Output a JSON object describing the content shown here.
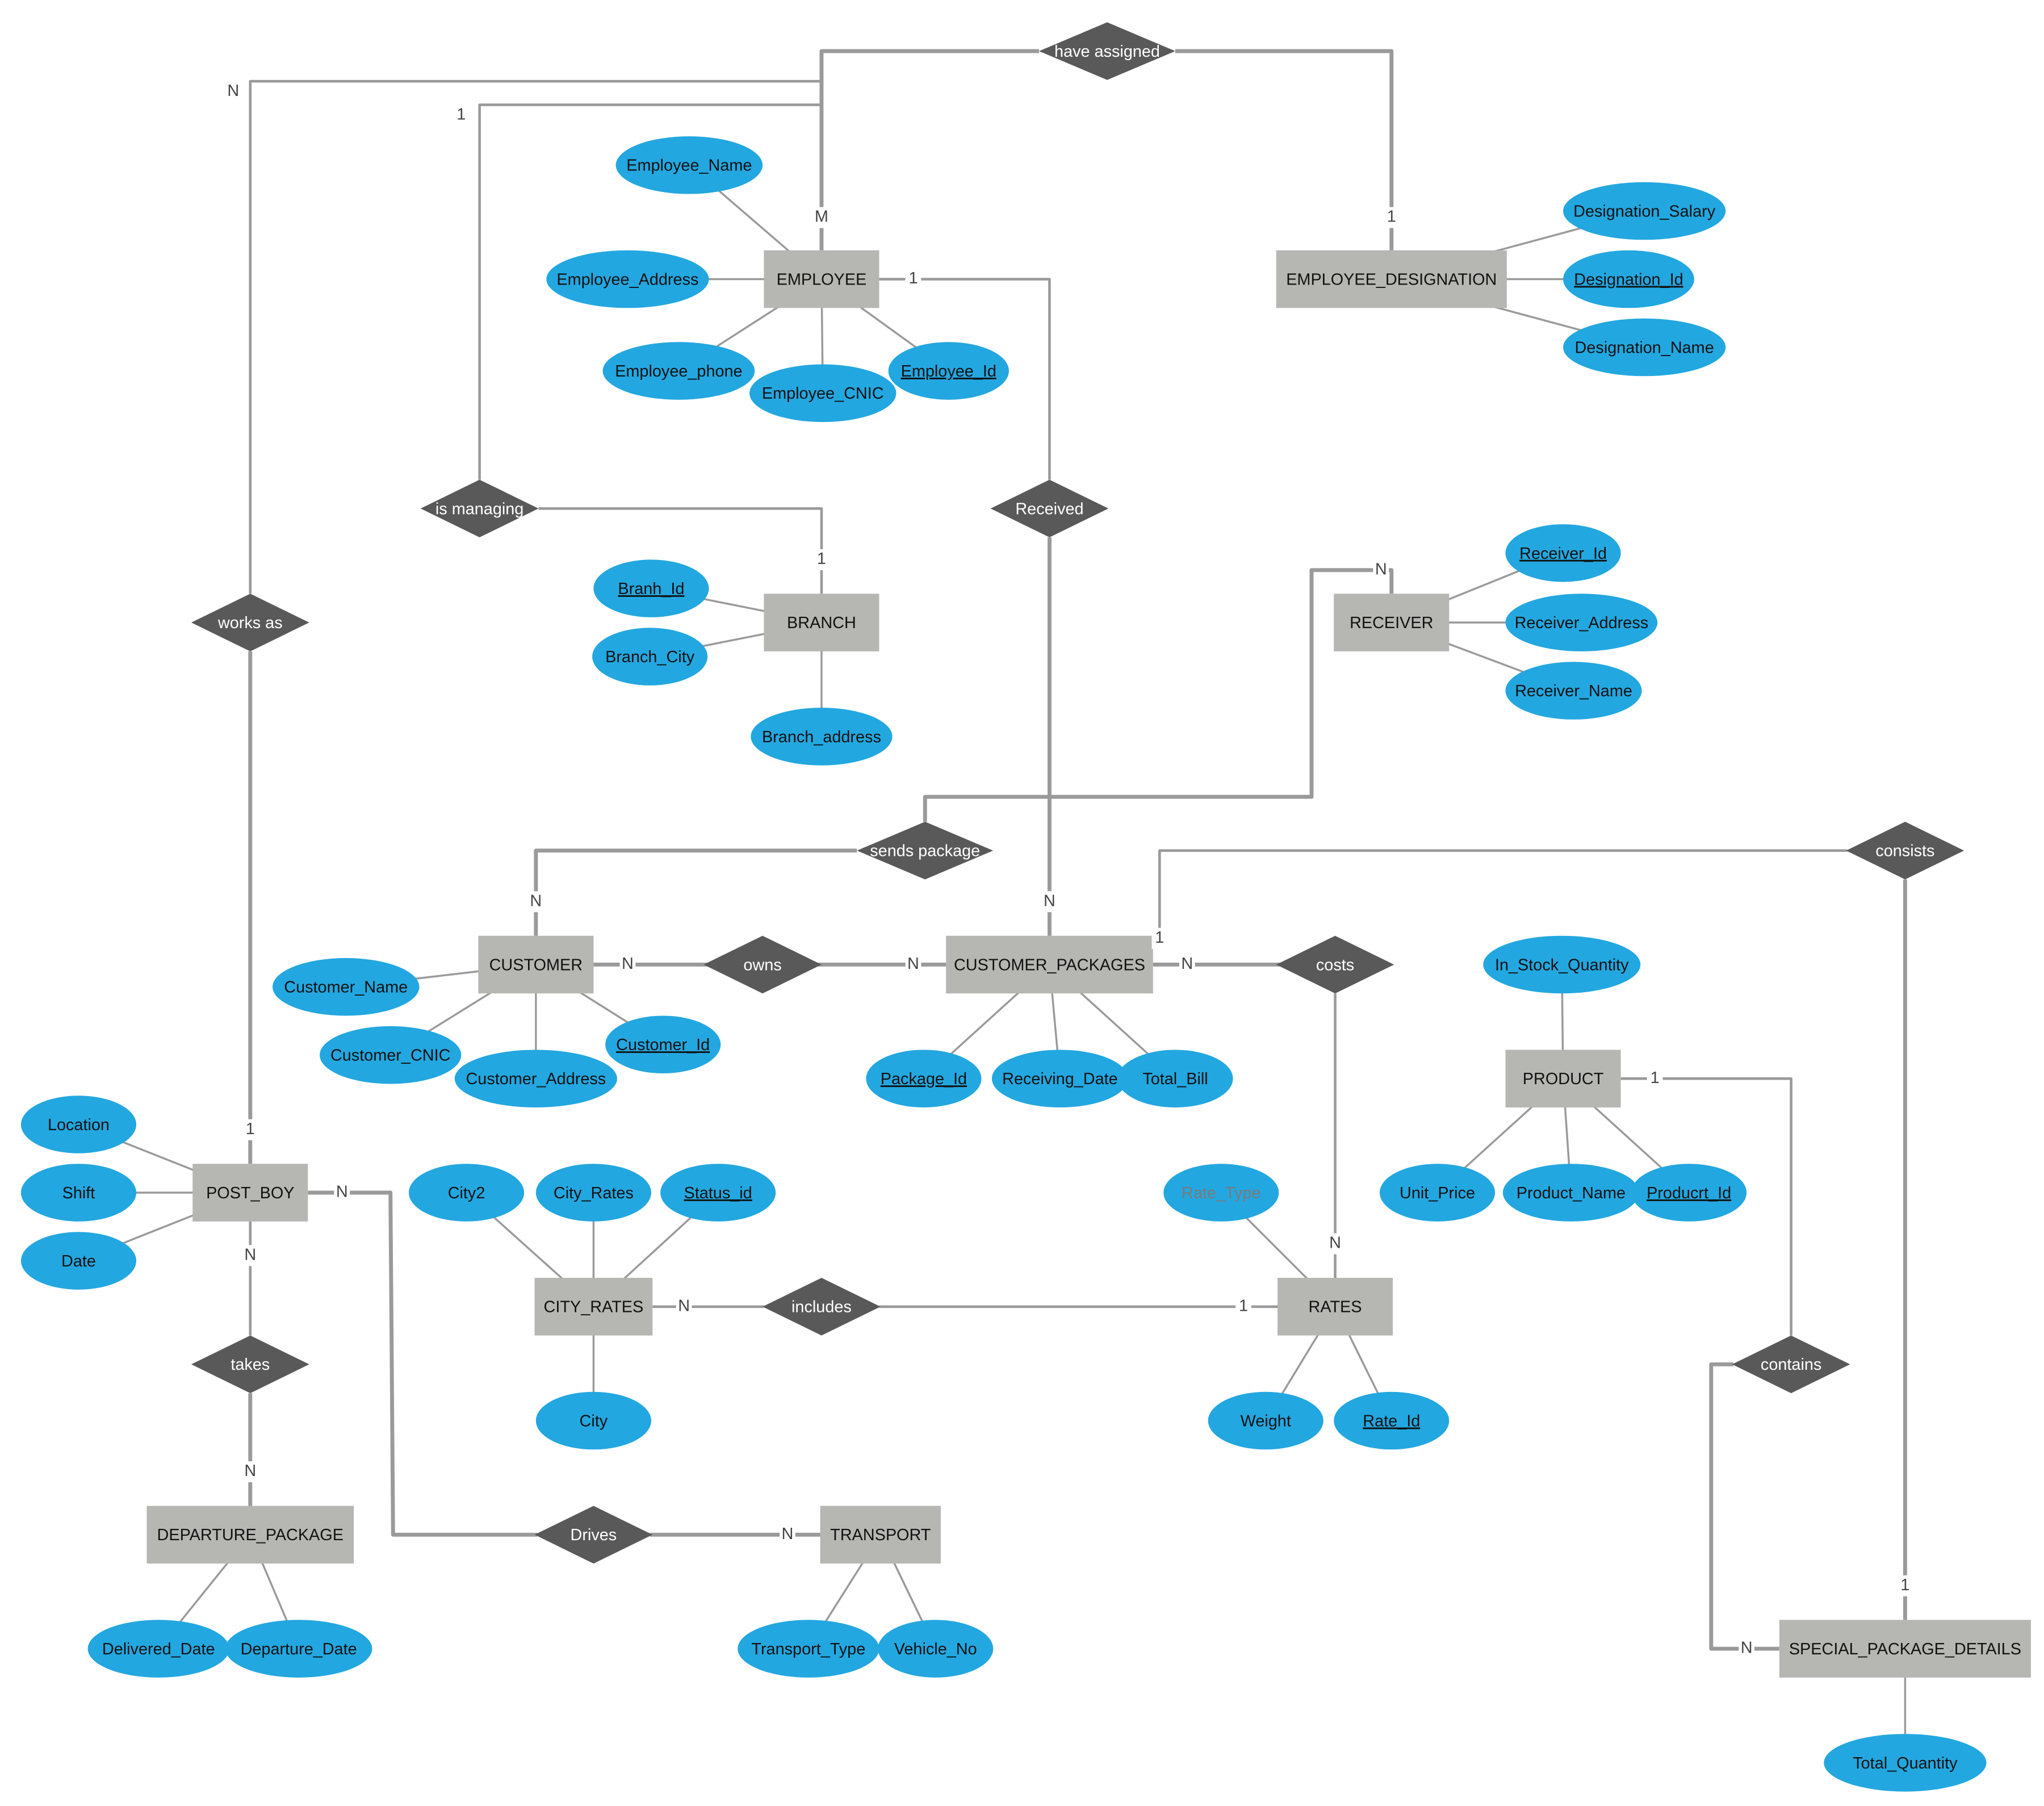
{
  "colors": {
    "entity_fill": "#b6b6b2",
    "relationship_fill": "#595959",
    "attribute_fill": "#23a7e0",
    "line": "#9a9a9a",
    "text_dark": "#111111",
    "text_light": "#ffffff",
    "muted_text": "#7a7a7a"
  },
  "entities": [
    "EMPLOYEE",
    "EMPLOYEE_DESIGNATION",
    "BRANCH",
    "RECEIVER",
    "CUSTOMER",
    "CUSTOMER_PACKAGES",
    "PRODUCT",
    "POST_BOY",
    "CITY_RATES",
    "RATES",
    "DEPARTURE_PACKAGE",
    "TRANSPORT",
    "SPECIAL_PACKAGE_DETAILS"
  ],
  "relationships": [
    "have assigned",
    "is managing",
    "Received",
    "works as",
    "sends package",
    "owns",
    "costs",
    "consists",
    "includes",
    "contains",
    "takes",
    "Drives"
  ],
  "attributes": [
    {
      "label": "Employee_Name",
      "key": false
    },
    {
      "label": "Employee_Address",
      "key": false
    },
    {
      "label": "Employee_phone",
      "key": false
    },
    {
      "label": "Employee_CNIC",
      "key": false
    },
    {
      "label": "Employee_Id",
      "key": true
    },
    {
      "label": "Designation_Salary",
      "key": false
    },
    {
      "label": "Designation_Id",
      "key": true
    },
    {
      "label": "Designation_Name",
      "key": false
    },
    {
      "label": "Branh_Id",
      "key": true
    },
    {
      "label": "Branch_City",
      "key": false
    },
    {
      "label": "Branch_address",
      "key": false
    },
    {
      "label": "Receiver_Id",
      "key": true
    },
    {
      "label": "Receiver_Address",
      "key": false
    },
    {
      "label": "Receiver_Name",
      "key": false
    },
    {
      "label": "Customer_Name",
      "key": false
    },
    {
      "label": "Customer_CNIC",
      "key": false
    },
    {
      "label": "Customer_Address",
      "key": false
    },
    {
      "label": "Customer_Id",
      "key": true
    },
    {
      "label": "Package_Id",
      "key": true
    },
    {
      "label": "Receiving_Date",
      "key": false
    },
    {
      "label": "Total_Bill",
      "key": false
    },
    {
      "label": "In_Stock_Quantity",
      "key": false
    },
    {
      "label": "Unit_Price",
      "key": false
    },
    {
      "label": "Product_Name",
      "key": false
    },
    {
      "label": "Producrt_Id",
      "key": true
    },
    {
      "label": "Location",
      "key": false
    },
    {
      "label": "Shift",
      "key": false
    },
    {
      "label": "Date",
      "key": false
    },
    {
      "label": "City2",
      "key": false
    },
    {
      "label": "City_Rates",
      "key": false
    },
    {
      "label": "Status_id",
      "key": true
    },
    {
      "label": "City",
      "key": false
    },
    {
      "label": "Rate_Type",
      "key": false,
      "muted": true
    },
    {
      "label": "Weight",
      "key": false
    },
    {
      "label": "Rate_Id",
      "key": true
    },
    {
      "label": "Delivered_Date",
      "key": false
    },
    {
      "label": "Departure_Date",
      "key": false
    },
    {
      "label": "Transport_Type",
      "key": false
    },
    {
      "label": "Vehicle_No",
      "key": false
    },
    {
      "label": "Total_Quantity",
      "key": false
    }
  ],
  "cardinalities": [
    "M",
    "1",
    "N",
    "1",
    "1",
    "1",
    "1",
    "N",
    "N",
    "N",
    "N",
    "N",
    "N",
    "N",
    "N",
    "1",
    "1",
    "N",
    "N",
    "N",
    "N",
    "1",
    "1",
    "N",
    "N"
  ]
}
